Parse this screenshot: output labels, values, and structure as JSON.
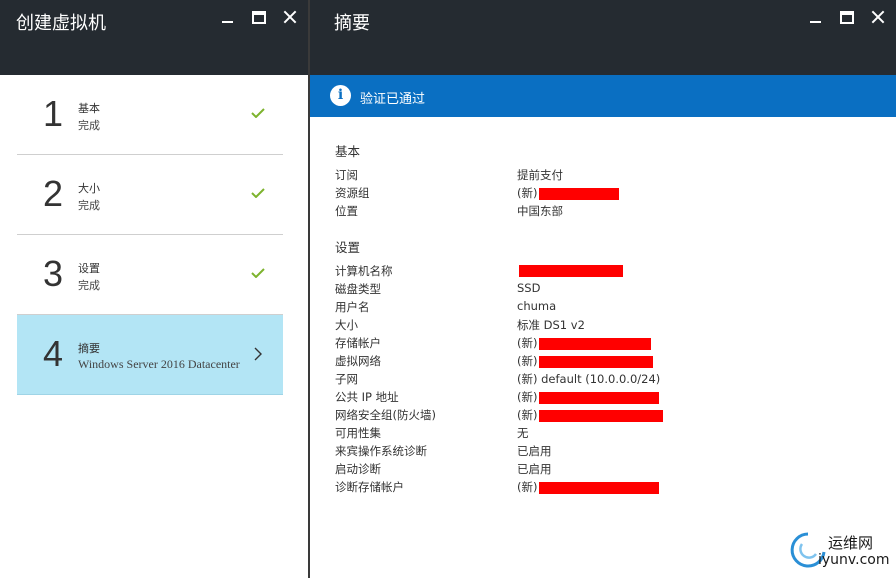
{
  "left_blade": {
    "title": "创建虚拟机",
    "steps": [
      {
        "num": "1",
        "title": "基本",
        "subtitle": "完成",
        "state": "done"
      },
      {
        "num": "2",
        "title": "大小",
        "subtitle": "完成",
        "state": "done"
      },
      {
        "num": "3",
        "title": "设置",
        "subtitle": "完成",
        "state": "done"
      },
      {
        "num": "4",
        "title": "摘要",
        "subtitle": "Windows Server 2016 Datacenter",
        "state": "active"
      }
    ]
  },
  "right_blade": {
    "title": "摘要",
    "notice": "验证已通过",
    "basics": {
      "heading": "基本",
      "rows": [
        {
          "label": "订阅",
          "value": "提前支付"
        },
        {
          "label": "资源组",
          "value": "(新)"
        },
        {
          "label": "位置",
          "value": "中国东部"
        }
      ]
    },
    "settings": {
      "heading": "设置",
      "rows": [
        {
          "label": "计算机名称",
          "value": ""
        },
        {
          "label": "磁盘类型",
          "value": "SSD"
        },
        {
          "label": "用户名",
          "value": "chuma"
        },
        {
          "label": "大小",
          "value": "标准 DS1 v2"
        },
        {
          "label": "存储帐户",
          "value": "(新)"
        },
        {
          "label": "虚拟网络",
          "value": "(新)"
        },
        {
          "label": "子网",
          "value": "(新) default (10.0.0.0/24)"
        },
        {
          "label": "公共 IP 地址",
          "value": "(新)"
        },
        {
          "label": "网络安全组(防火墙)",
          "value": "(新)"
        },
        {
          "label": "可用性集",
          "value": "无"
        },
        {
          "label": "来宾操作系统诊断",
          "value": "已启用"
        },
        {
          "label": "启动诊断",
          "value": "已启用"
        },
        {
          "label": "诊断存储帐户",
          "value": "(新)"
        }
      ]
    }
  },
  "watermark": {
    "cn": "运维网",
    "en": "iyunv.com"
  },
  "colors": {
    "header": "#252b31",
    "notice": "#0a6fc2",
    "active_step": "#b3e5f5",
    "check": "#7db32e",
    "redaction": "#ff0000"
  }
}
